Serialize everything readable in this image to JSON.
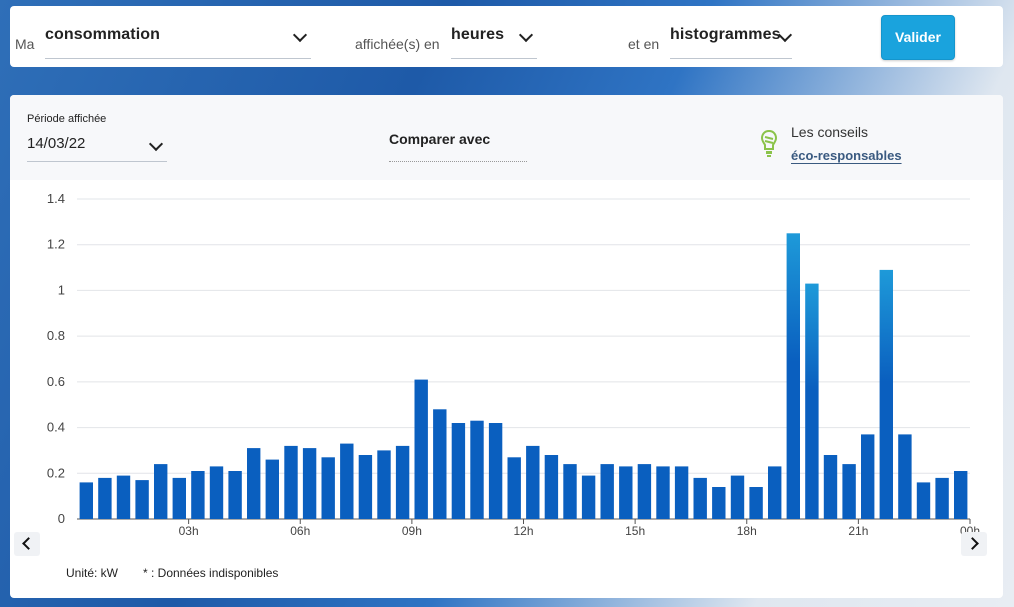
{
  "filters": {
    "ma_label": "Ma",
    "ma_value": "consommation",
    "affichee_label": "affichée(s) en",
    "affichee_value": "heures",
    "et_label": "et en",
    "et_value": "histogrammes",
    "validate_label": "Valider"
  },
  "period": {
    "label": "Période affichée",
    "value": "14/03/22"
  },
  "compare_label": "Comparer avec",
  "tips": {
    "line1": "Les conseils",
    "link": "éco-responsables",
    "icon": "eco-bulb-icon"
  },
  "footer": {
    "unit": "Unité: kW",
    "unavailable": "* : Données indisponibles"
  },
  "colors": {
    "bar_base": "#0a5fbf",
    "bar_top": "#1e9ad9",
    "accent": "#1aa3dd"
  },
  "chart_data": {
    "type": "bar",
    "ylim": [
      0,
      1.4
    ],
    "yticks": [
      "0",
      "0.2",
      "0.4",
      "0.6",
      "0.8",
      "1",
      "1.2",
      "1.4"
    ],
    "xticks": [
      "03h",
      "06h",
      "09h",
      "12h",
      "15h",
      "18h",
      "21h",
      "00h"
    ],
    "unit": "kW",
    "grid": true,
    "values": [
      0.16,
      0.18,
      0.19,
      0.17,
      0.24,
      0.18,
      0.21,
      0.23,
      0.21,
      0.31,
      0.26,
      0.32,
      0.31,
      0.27,
      0.33,
      0.28,
      0.3,
      0.32,
      0.61,
      0.48,
      0.42,
      0.43,
      0.42,
      0.27,
      0.32,
      0.28,
      0.24,
      0.19,
      0.24,
      0.23,
      0.24,
      0.23,
      0.23,
      0.18,
      0.14,
      0.19,
      0.14,
      0.23,
      1.25,
      1.03,
      0.28,
      0.24,
      0.37,
      1.09,
      0.37,
      0.16,
      0.18,
      0.21
    ]
  }
}
